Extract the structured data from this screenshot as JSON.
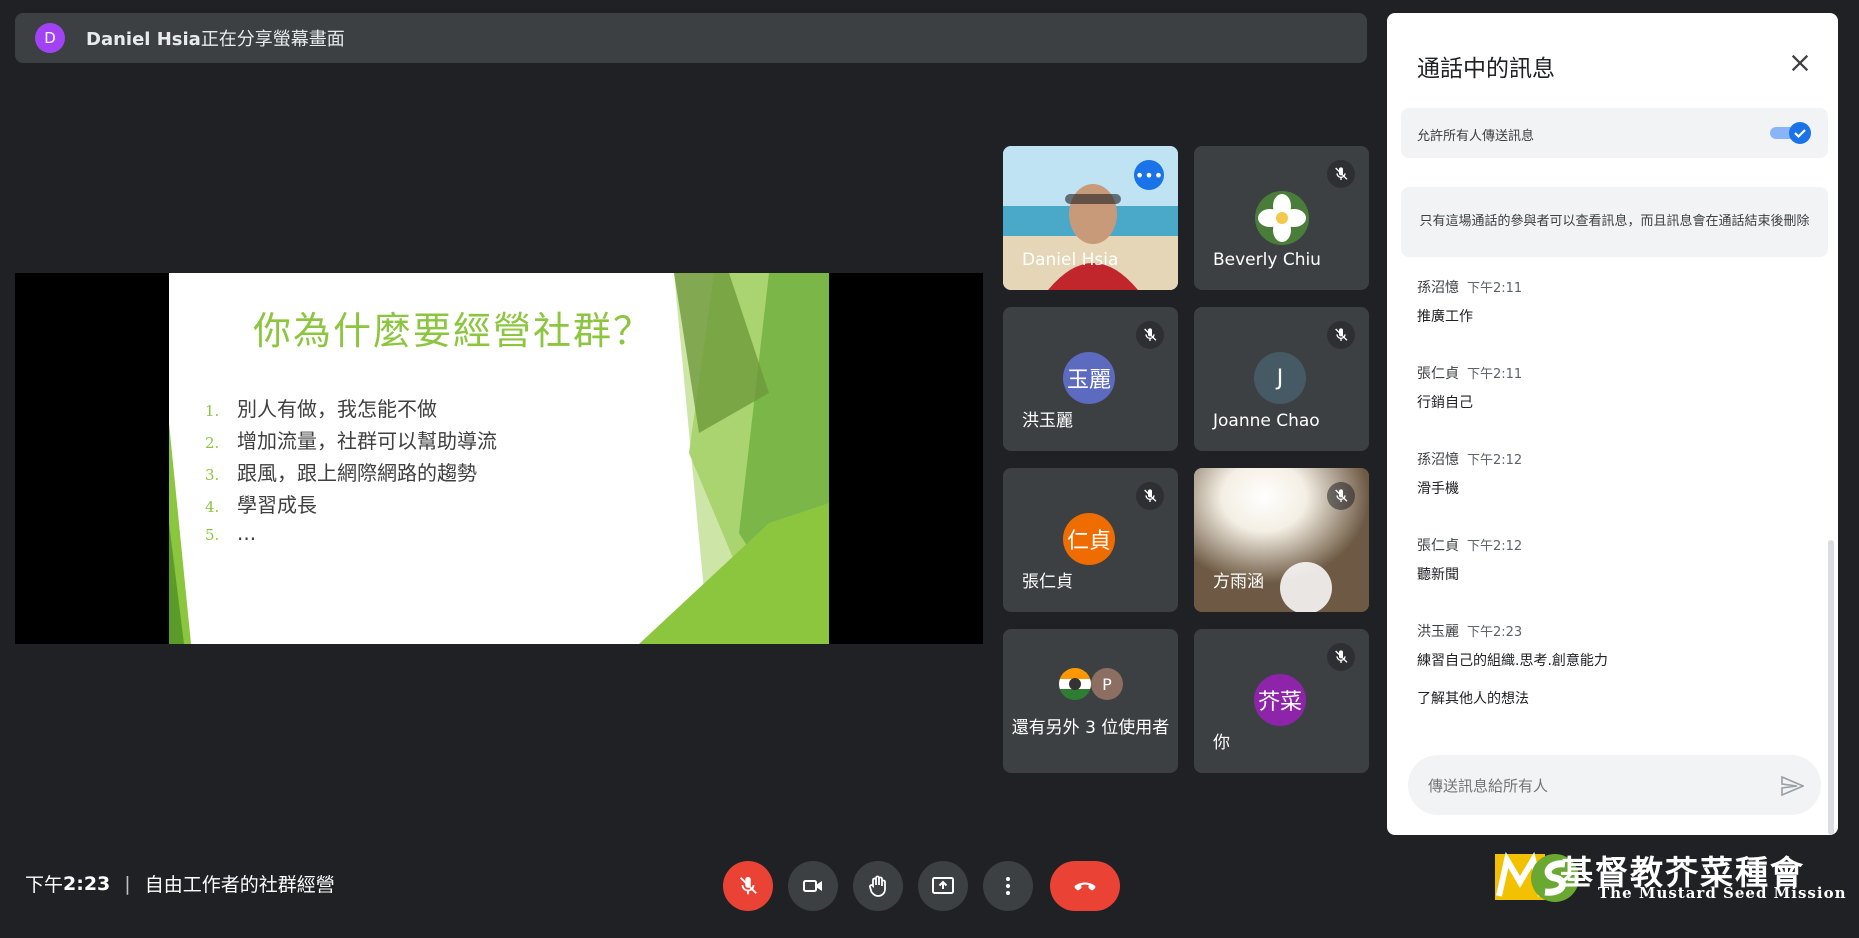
{
  "banner": {
    "initial": "D",
    "presenter": "Daniel Hsia",
    "suffix": "正在分享螢幕畫面"
  },
  "slide": {
    "title": "你為什麼要經營社群？",
    "items": [
      {
        "num": "1.",
        "text": "別人有做，我怎能不做"
      },
      {
        "num": "2.",
        "text": "增加流量，社群可以幫助導流"
      },
      {
        "num": "3.",
        "text": "跟風，跟上網際網路的趨勢"
      },
      {
        "num": "4.",
        "text": "學習成長"
      },
      {
        "num": "5.",
        "text": "..."
      }
    ]
  },
  "participants": [
    {
      "name": "Daniel Hsia",
      "type": "video",
      "active": true
    },
    {
      "name": "Beverly Chiu",
      "type": "flower",
      "muted": true
    },
    {
      "name": "洪玉麗",
      "avatar": "玉麗",
      "color": "#5c6bc0",
      "muted": true
    },
    {
      "name": "Joanne Chao",
      "avatar": "J",
      "color": "#455a64",
      "muted": true
    },
    {
      "name": "張仁貞",
      "avatar": "仁貞",
      "color": "#ef6c00",
      "muted": true
    },
    {
      "name": "方雨涵",
      "type": "camera",
      "muted": true
    },
    {
      "name": "還有另外 3 位使用者",
      "extra_initial": "P"
    },
    {
      "name": "你",
      "avatar": "芥菜",
      "color": "#8e24aa",
      "muted": true
    }
  ],
  "chat": {
    "title": "通話中的訊息",
    "allow_label": "允許所有人傳送訊息",
    "allow_on": true,
    "notice": "只有這場通話的參與者可以查看訊息，而且訊息會在通話結束後刪除",
    "messages": [
      {
        "sender": "孫沼憶",
        "time": "下午2:11",
        "lines": [
          "推廣工作"
        ]
      },
      {
        "sender": "張仁貞",
        "time": "下午2:11",
        "lines": [
          "行銷自己"
        ]
      },
      {
        "sender": "孫沼憶",
        "time": "下午2:12",
        "lines": [
          "滑手機"
        ]
      },
      {
        "sender": "張仁貞",
        "time": "下午2:12",
        "lines": [
          "聽新聞"
        ]
      },
      {
        "sender": "洪玉麗",
        "time": "下午2:23",
        "lines": [
          "練習自己的組織.思考.創意能力",
          "了解其他人的想法"
        ]
      }
    ],
    "input_placeholder": "傳送訊息給所有人"
  },
  "footer": {
    "time_prefix": "下午",
    "time": "2:23",
    "separator": "|",
    "meeting_name": "自由工作者的社群經營"
  },
  "controls": [
    "mic-off",
    "camera",
    "raise-hand",
    "present",
    "more",
    "end-call"
  ],
  "logo": {
    "mark": "MS",
    "zh": "基督教芥菜種會",
    "en": "The Mustard Seed Mission"
  },
  "colors": {
    "accent_red": "#ea4335",
    "toggle_blue": "#1a73e8",
    "slide_green": "#8cc63f"
  }
}
